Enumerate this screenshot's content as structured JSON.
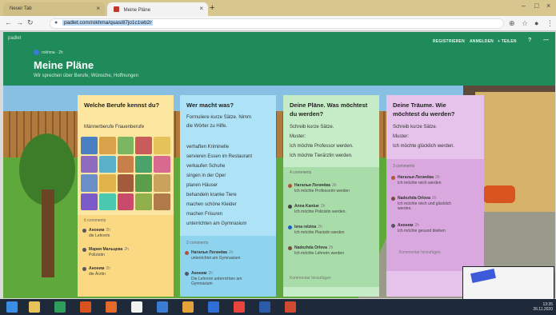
{
  "browser": {
    "tabs": [
      {
        "label": "Neuer Tab"
      },
      {
        "label": "Meine Pläne"
      }
    ],
    "url": "padlet.com/rokhma/quasi87jo1c1wb2r"
  },
  "padlet": {
    "logo": "padlet",
    "author": "rokhma",
    "author_time": "2h",
    "title": "Meine Pläne",
    "subtitle": "Wir sprechen über Berufe, Wünsche, Hoffnungen",
    "links": [
      "REGISTRIEREN",
      "ANMELDEN",
      "+ TEILEN"
    ]
  },
  "columns": [
    {
      "title_lines": [
        "Welche Berufe kennst du?"
      ],
      "text_lines": [
        "Männerberufe   Frauenberufe"
      ],
      "comment_count": "6 comments",
      "comments": [
        {
          "name": "Аноним",
          "time": "2h",
          "text": [
            "die Lehrerin"
          ]
        },
        {
          "name": "Мария Мальцева",
          "time": "2h",
          "text": [
            "Polizistin"
          ]
        },
        {
          "name": "Аноним",
          "time": "2h",
          "text": [
            "die Ärztin"
          ]
        }
      ]
    },
    {
      "title_lines": [
        "Wer macht was?"
      ],
      "text_lines": [
        "Formuliere kurze Sätze. Nimm",
        "die  Wörter  zu Hilfe.",
        "",
        "verhaften Kriminelle",
        "servieren Essen im Restaurant",
        "verkaufen Schuhe",
        "singen in der Oper",
        "planen Häuser",
        "behandeln kranke Tiere",
        "machen schöne Kleider",
        "machen Frisuren",
        "unterrichten am Gymnasium"
      ],
      "comment_count": "2 comments",
      "comments": [
        {
          "name": "Наталья Логачёва",
          "time": "2h",
          "text": [
            "unterrichtet am Gymnasium"
          ]
        },
        {
          "name": "Аноним",
          "time": "2h",
          "text": [
            "Die Lehrerin unterrichten am",
            "Gymnasium"
          ]
        }
      ]
    },
    {
      "title_lines": [
        "Deine Pläne. Was möchtest",
        "du werden?"
      ],
      "text_lines": [
        "Schreib kurze Sätze.",
        "Muster:",
        "Ich möchte Professor werden.",
        "Ich möchte  Tierärztin werden."
      ],
      "comment_count": "4 comments",
      "comments": [
        {
          "name": "Наталья Логачёва",
          "time": "2h",
          "text": [
            "Ich möchte Professorin werden"
          ]
        },
        {
          "name": "Anna Kantue",
          "time": "2h",
          "text": [
            "Ich möchte Polizistin werden."
          ]
        },
        {
          "name": "lena relzina",
          "time": "2h",
          "text": [
            "Ich möchte Pianistin werden"
          ]
        },
        {
          "name": "Nadezhda Orlova",
          "time": "2h",
          "text": [
            "Ich möchte Lehrerin werden"
          ]
        }
      ],
      "add_comment": "Kommentar hinzufügen"
    },
    {
      "title_lines": [
        "Deine Träume. Wie",
        "möchtest du werden?"
      ],
      "text_lines": [
        "Schreib kurze Sätze.",
        "Muster:",
        "Ich möchte glücklich werden."
      ],
      "comment_count": "3 comments",
      "comments": [
        {
          "name": "Наталья Логачёва",
          "time": "2h",
          "text": [
            "Ich möchte reich werden"
          ]
        },
        {
          "name": "Nadezhda Orlova",
          "time": "2h",
          "text": [
            "Ich möchte reich und glücklich",
            "werden."
          ]
        },
        {
          "name": "Аноним",
          "time": "2h",
          "text": [
            "Ich möchte gesund bleiben"
          ]
        }
      ],
      "add_comment": "Kommentar hinzufügen"
    }
  ],
  "taskbar": {
    "time": "13:35",
    "date": "26.11.2020"
  }
}
